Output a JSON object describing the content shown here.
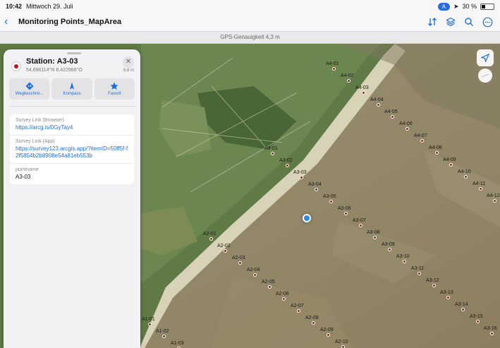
{
  "status_bar": {
    "time": "10:42",
    "date": "Mittwoch 29. Juli",
    "indicator": "A",
    "battery": "30 %"
  },
  "nav": {
    "title": "Monitoring Points_MapArea",
    "icons": [
      "sort-icon",
      "layers-icon",
      "search-icon",
      "more-icon"
    ]
  },
  "gps": {
    "text": "GPS-Genauigkeit 4,3 m"
  },
  "station": {
    "title": "Station: A3-03",
    "coords": "54,696114°N 8,422968°O",
    "distance": "6,8 m",
    "actions": [
      {
        "label": "Wegbeschrei...",
        "icon": "directions-icon"
      },
      {
        "label": "Kompass",
        "icon": "compass-icon"
      },
      {
        "label": "Favorit",
        "icon": "star-icon"
      }
    ],
    "fields": [
      {
        "key": "Survey Link (Browser)",
        "value": "https://arcg.is/0GyTay4",
        "link": true
      },
      {
        "key": "Survey Link (App)",
        "value": "https://survey123.arcgis.app/?itemID=50ff5f-f2f5854b2b8908e54a81eb553b",
        "link": true
      },
      {
        "key": "pointname",
        "value": "A3-03",
        "link": false
      }
    ]
  },
  "map_points": [
    "A4-01",
    "A4-02",
    "A4-03",
    "A4-04",
    "A4-05",
    "A4-06",
    "A4-07",
    "A4-08",
    "A4-09",
    "A4-10",
    "A4-11",
    "A4-12",
    "A3-01",
    "A3-02",
    "A3-03",
    "A3-04",
    "A3-05",
    "A3-06",
    "A3-07",
    "A3-08",
    "A3-09",
    "A3-10",
    "A3-11",
    "A3-12",
    "A3-13",
    "A3-14",
    "A3-15",
    "A3-16",
    "A2-01",
    "A2-02",
    "A2-03",
    "A2-04",
    "A2-05",
    "A2-06",
    "A2-07",
    "A2-08",
    "A2-09",
    "A2-10",
    "A1-01",
    "A1-02",
    "A1-03"
  ],
  "colors": {
    "accent": "#1d6fe0",
    "station_marker": "#c0101a",
    "point_marker": "#7d2b16"
  }
}
